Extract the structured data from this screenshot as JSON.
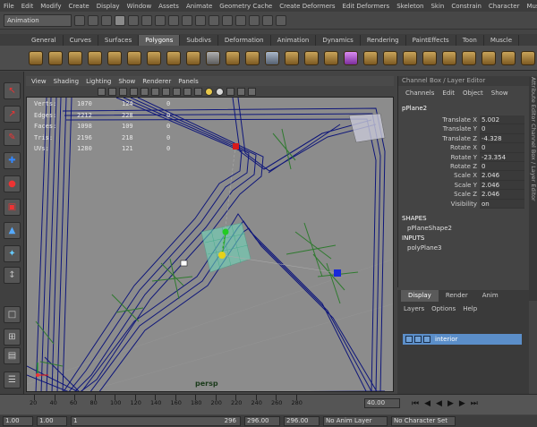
{
  "menubar": [
    "File",
    "Edit",
    "Modify",
    "Create",
    "Display",
    "Window",
    "Assets",
    "Animate",
    "Geometry Cache",
    "Create Deformers",
    "Edit Deformers",
    "Skeleton",
    "Skin",
    "Constrain",
    "Character",
    "Muscle"
  ],
  "statusline": {
    "mode": "Animation"
  },
  "shelf_tabs": {
    "items": [
      "General",
      "Curves",
      "Surfaces",
      "Polygons",
      "Subdivs",
      "Deformation",
      "Animation",
      "Dynamics",
      "Rendering",
      "PaintEffects",
      "Toon",
      "Muscle"
    ],
    "active": "Polygons"
  },
  "panel_menu": [
    "View",
    "Shading",
    "Lighting",
    "Show",
    "Renderer",
    "Panels"
  ],
  "stats": {
    "rows": [
      {
        "label": "Verts:",
        "v1": "1070",
        "v2": "124",
        "v3": "0"
      },
      {
        "label": "Edges:",
        "v1": "2212",
        "v2": "228",
        "v3": "0"
      },
      {
        "label": "Faces:",
        "v1": "1098",
        "v2": "109",
        "v3": "0"
      },
      {
        "label": "Tris:",
        "v1": "2196",
        "v2": "218",
        "v3": "0"
      },
      {
        "label": "UVs:",
        "v1": "1280",
        "v2": "121",
        "v3": "0"
      }
    ]
  },
  "viewport": {
    "camera": "persp"
  },
  "channel_box": {
    "title": "Channel Box / Layer Editor",
    "menu": [
      "Channels",
      "Edit",
      "Object",
      "Show"
    ],
    "object": "pPlane2",
    "attributes": [
      {
        "name": "Translate X",
        "value": "5.002"
      },
      {
        "name": "Translate Y",
        "value": "0"
      },
      {
        "name": "Translate Z",
        "value": "-4.328"
      },
      {
        "name": "Rotate X",
        "value": "0"
      },
      {
        "name": "Rotate Y",
        "value": "-23.354"
      },
      {
        "name": "Rotate Z",
        "value": "0"
      },
      {
        "name": "Scale X",
        "value": "2.046"
      },
      {
        "name": "Scale Y",
        "value": "2.046"
      },
      {
        "name": "Scale Z",
        "value": "2.046"
      },
      {
        "name": "Visibility",
        "value": "on"
      }
    ],
    "shapes_label": "SHAPES",
    "shape": "pPlaneShape2",
    "inputs_label": "INPUTS",
    "input": "polyPlane3"
  },
  "side_tabs": "Attribute Editor    Channel Box / Layer Editor",
  "layer_editor": {
    "tabs": [
      "Display",
      "Render",
      "Anim"
    ],
    "active_tab": "Display",
    "menu": [
      "Layers",
      "Options",
      "Help"
    ],
    "layer_name": "interior"
  },
  "timeline": {
    "ticks": [
      "20",
      "40",
      "60",
      "80",
      "100",
      "120",
      "140",
      "160",
      "180",
      "200",
      "220",
      "240",
      "260",
      "280"
    ],
    "current_frame": "40.00"
  },
  "range": {
    "start": "1.00",
    "start2": "1.00",
    "frame": "1",
    "end_marker": "296",
    "end1": "296.00",
    "end2": "296.00",
    "anim_layer": "No Anim Layer",
    "char_set": "No Character Set"
  }
}
